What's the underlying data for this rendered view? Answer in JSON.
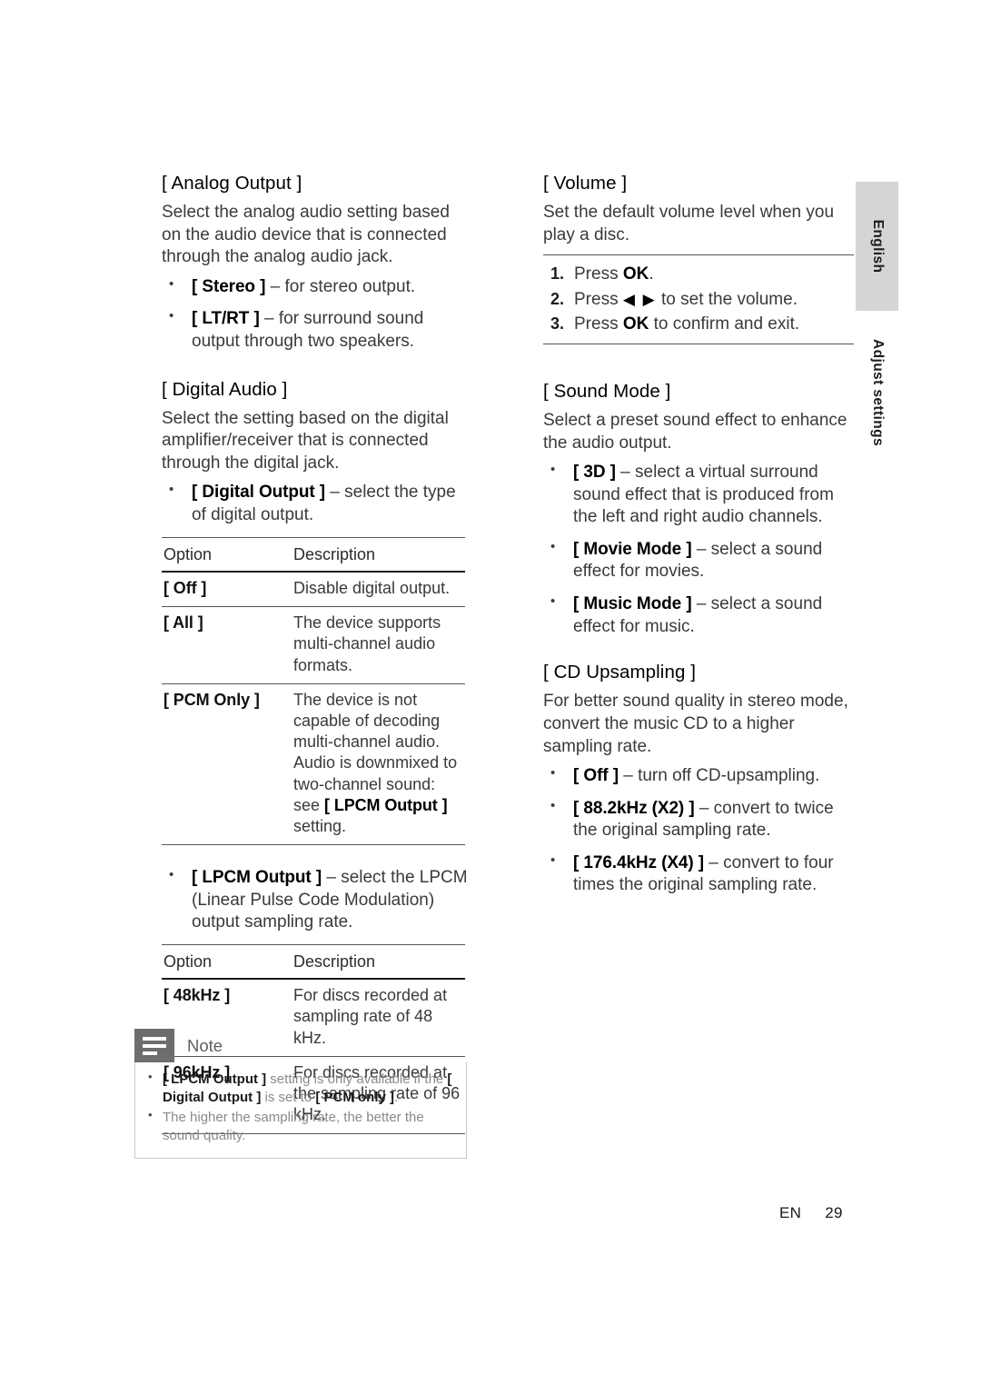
{
  "page": {
    "footer_locale": "EN",
    "footer_page_number": "29",
    "side_tab_language": "English",
    "side_tab_section": "Adjust settings"
  },
  "left_column": {
    "analog_output": {
      "heading": "[ Analog Output ]",
      "paragraph": "Select the analog audio setting based on the audio device that is connected through the analog audio jack.",
      "bullets": [
        {
          "term": "[ Stereo ]",
          "rest": " – for stereo output."
        },
        {
          "term": "[ LT/RT ]",
          "rest": " – for surround sound output through two speakers."
        }
      ]
    },
    "digital_audio": {
      "heading": "[ Digital Audio ]",
      "paragraph": "Select the setting based on the digital amplifier/receiver that is connected through the digital jack.",
      "bullet_digital_output": {
        "term": "[ Digital Output ]",
        "rest": " – select the type of digital output."
      },
      "table": {
        "headers": [
          "Option",
          "Description"
        ],
        "rows": [
          {
            "option": "[ Off ]",
            "description": "Disable digital output."
          },
          {
            "option": "[ All ]",
            "description": "The device supports multi-channel audio formats."
          },
          {
            "option": "[ PCM Only ]",
            "description_pre": "The device is not capable of decoding multi-channel audio. Audio is downmixed to two-channel sound: see ",
            "description_term": "[ LPCM Output ]",
            "description_post": " setting."
          }
        ]
      },
      "bullet_lpcm_output": {
        "term": "[ LPCM Output ]",
        "rest": " – select the LPCM (Linear Pulse Code Modulation) output sampling rate."
      },
      "table2": {
        "headers": [
          "Option",
          "Description"
        ],
        "rows": [
          {
            "option": "[ 48kHz ]",
            "description": "For discs recorded at sampling rate of 48 kHz."
          },
          {
            "option": "[ 96kHz ]",
            "description": "For discs recorded at the sampling rate of 96 kHz."
          }
        ]
      }
    },
    "note": {
      "title": "Note",
      "icon": "note-lines-icon",
      "items": [
        {
          "seg1_bold": "[ LPCM Output ]",
          "seg2": " setting is only available if the ",
          "seg3_bold": "[ Digital Output ]",
          "seg4": " is set to ",
          "seg5_bold": "[ PCM only ]",
          "seg6": "."
        },
        {
          "text": "The higher the sampling rate, the better the sound quality."
        }
      ]
    }
  },
  "right_column": {
    "volume": {
      "heading": "[ Volume ]",
      "paragraph": "Set the default volume level when you play a disc.",
      "steps": [
        {
          "num": "1.",
          "pre": "Press ",
          "kbd": "OK",
          "post": "."
        },
        {
          "num": "2.",
          "pre": "Press ",
          "arrows": "◀ ▶",
          "post": " to set the volume."
        },
        {
          "num": "3.",
          "pre": "Press ",
          "kbd": "OK",
          "post": " to confirm and exit."
        }
      ]
    },
    "sound_mode": {
      "heading": "[ Sound Mode ]",
      "paragraph": "Select a preset sound effect to enhance the audio output.",
      "bullets": [
        {
          "term": "[ 3D ]",
          "rest": " – select a virtual surround sound effect that is produced from the left and right audio channels."
        },
        {
          "term": "[ Movie Mode ]",
          "rest": " – select a sound effect for movies."
        },
        {
          "term": "[ Music Mode ]",
          "rest": " – select a sound effect for music."
        }
      ]
    },
    "cd_upsampling": {
      "heading": "[ CD Upsampling ]",
      "paragraph": "For better sound quality in stereo mode, convert the music CD to a higher sampling rate.",
      "bullets": [
        {
          "term": "[ Off ]",
          "rest": " – turn off CD-upsampling."
        },
        {
          "term": "[ 88.2kHz (X2) ]",
          "rest": " – convert to twice the original sampling rate."
        },
        {
          "term": "[ 176.4kHz (X4) ]",
          "rest": " – convert to four times the original sampling rate."
        }
      ]
    }
  }
}
